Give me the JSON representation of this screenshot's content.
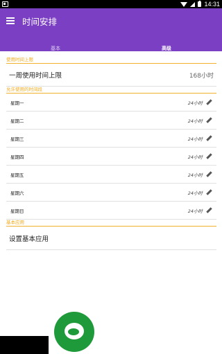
{
  "status_bar": {
    "time": "14:31"
  },
  "app": {
    "title": "时间安排"
  },
  "tabs": [
    {
      "label": "基本",
      "active": false
    },
    {
      "label": "高级",
      "active": true
    }
  ],
  "sections": {
    "usage_limit": {
      "header": "使用时间上限",
      "row_label": "一周使用时间上限",
      "row_value": "168小时"
    },
    "allowed_periods": {
      "header": "允许使用的时间段",
      "days": [
        {
          "label": "星期一",
          "hours": "24小时"
        },
        {
          "label": "星期二",
          "hours": "24小时"
        },
        {
          "label": "星期三",
          "hours": "24小时"
        },
        {
          "label": "星期四",
          "hours": "24小时"
        },
        {
          "label": "星期五",
          "hours": "24小时"
        },
        {
          "label": "星期六",
          "hours": "24小时"
        },
        {
          "label": "星期日",
          "hours": "24小时"
        }
      ]
    },
    "basic_apps": {
      "header": "基本应用",
      "row_label": "设置基本应用"
    }
  },
  "colors": {
    "appbar": "#7b3fc4",
    "accent": "#f2a91a",
    "logo": "#1f9a3a"
  }
}
